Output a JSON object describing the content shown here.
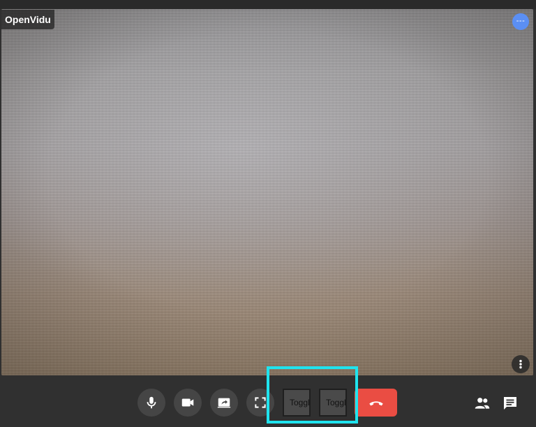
{
  "app": {
    "brand_label": "OpenVidu"
  },
  "participant": {
    "avatar_text": "---"
  },
  "toolbar": {
    "mic_icon": "microphone-icon",
    "camera_icon": "videocam-icon",
    "screenshare_icon": "screen-share-icon",
    "fullscreen_icon": "fullscreen-icon",
    "toggle_video_label": "Toggle Video",
    "toggle_audio_label": "Toggle Audio",
    "hangup_icon": "call-end-icon",
    "participants_icon": "people-icon",
    "chat_icon": "chat-icon"
  },
  "colors": {
    "accent_avatar": "#5b8ff4",
    "hangup": "#ea4d43",
    "highlight": "#1fe3ee",
    "background": "#303030"
  }
}
